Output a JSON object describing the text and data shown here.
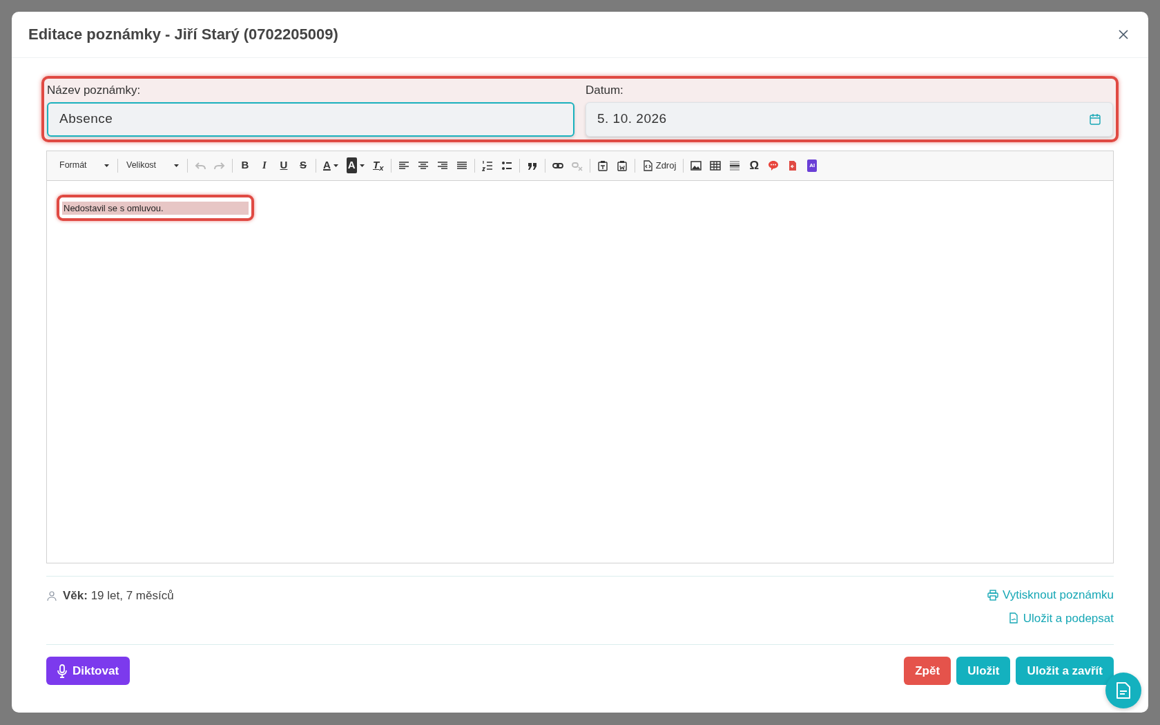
{
  "dialog": {
    "title": "Editace poznámky - Jiří Starý (0702205009)"
  },
  "form": {
    "highlighted": true,
    "fields": [
      {
        "kind": "text",
        "label": "Název poznámky:",
        "value": "Absence",
        "focused": true
      },
      {
        "kind": "date",
        "label": "Datum:",
        "value": "5. 10. 2026",
        "focused": false
      }
    ]
  },
  "editor": {
    "toolbar": {
      "dropdowns": [
        {
          "label": "Formát"
        },
        {
          "label": "Velikost"
        }
      ],
      "groups": [
        [
          {
            "disabled": true
          },
          {
            "disabled": true
          }
        ],
        [
          {
            "glyph": "B",
            "disabled": false
          },
          {
            "glyph": "I",
            "disabled": false
          },
          {
            "glyph": "U",
            "disabled": false
          },
          {
            "glyph": "S",
            "disabled": false
          }
        ],
        [
          {
            "glyph": "A",
            "disabled": false
          },
          {
            "glyph": "A",
            "disabled": false
          },
          {
            "glyph": "T$_{x}$",
            "disabled": false
          }
        ],
        [
          {
            "disabled": false
          },
          {
            "disabled": false
          },
          {
            "disabled": false
          },
          {
            "disabled": false
          }
        ],
        [
          {
            "disabled": false
          },
          {
            "disabled": false
          }
        ],
        [
          {
            "disabled": false
          }
        ],
        [
          {
            "disabled": false
          },
          {
            "disabled": true
          }
        ],
        [
          {
            "disabled": false
          },
          {
            "disabled": false
          }
        ],
        [
          {
            "label": "Zdroj",
            "disabled": false
          }
        ],
        [
          {
            "disabled": false
          },
          {
            "disabled": false
          },
          {
            "disabled": false
          },
          {
            "glyph": "Ω",
            "disabled": false
          },
          {
            "disabled": false
          },
          {
            "disabled": false
          },
          {
            "glyph": "AI",
            "disabled": false
          }
        ]
      ]
    },
    "content": {
      "text": "Nedostavil se s omluvou.",
      "highlighted": true
    }
  },
  "info": {
    "age": "**Věk:** 19 let, 7 měsíců"
  },
  "links": [
    {
      "kind": "print",
      "label": "Vytisknout poznámku"
    },
    {
      "kind": "sign",
      "label": "Uložit a podepsat"
    }
  ],
  "dictate_button": {
    "label": "Diktovat"
  },
  "actions": [
    {
      "kind": "cancel",
      "label": "Zpět"
    },
    {
      "kind": "save",
      "label": "Uložit"
    },
    {
      "kind": "save",
      "label": "Uložit a zavřít"
    }
  ]
}
